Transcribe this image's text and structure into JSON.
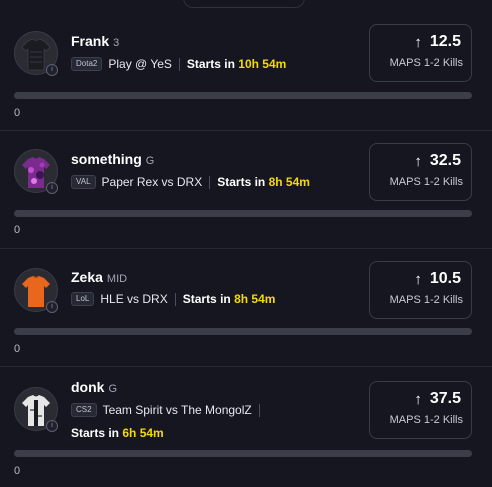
{
  "cards": [
    {
      "name": "Frank",
      "position": "3",
      "game": "Dota2",
      "match": "Play @ YeS",
      "starts_prefix": "Starts in",
      "starts_time": "10h 54m",
      "bet_value": "12.5",
      "bet_label": "MAPS 1-2 Kills",
      "progress": 0,
      "count": "0",
      "avatar_icon": "black-jersey-icon",
      "avatar_color": "#1b1c22"
    },
    {
      "name": "something",
      "position": "G",
      "game": "VAL",
      "match": "Paper Rex vs DRX",
      "starts_prefix": "Starts in",
      "starts_time": "8h 54m",
      "bet_value": "32.5",
      "bet_label": "MAPS 1-2 Kills",
      "progress": 0,
      "count": "0",
      "avatar_icon": "purple-jersey-icon",
      "avatar_color": "#7b2a8e"
    },
    {
      "name": "Zeka",
      "position": "MID",
      "game": "LoL",
      "match": "HLE vs DRX",
      "starts_prefix": "Starts in",
      "starts_time": "8h 54m",
      "bet_value": "10.5",
      "bet_label": "MAPS 1-2 Kills",
      "progress": 0,
      "count": "0",
      "avatar_icon": "orange-jersey-icon",
      "avatar_color": "#e8671c"
    },
    {
      "name": "donk",
      "position": "G",
      "game": "CS2",
      "match": "Team Spirit vs The MongolZ",
      "starts_prefix": "Starts in",
      "starts_time": "6h 54m",
      "bet_value": "37.5",
      "bet_label": "MAPS 1-2 Kills",
      "progress": 0,
      "count": "0",
      "avatar_icon": "white-jersey-icon",
      "avatar_color": "#e6e6e6"
    }
  ],
  "colors": {
    "accent": "#f5d90a",
    "background": "#15161f",
    "track": "#3b3d49"
  },
  "bet_arrow": "↑",
  "info_glyph": "i"
}
